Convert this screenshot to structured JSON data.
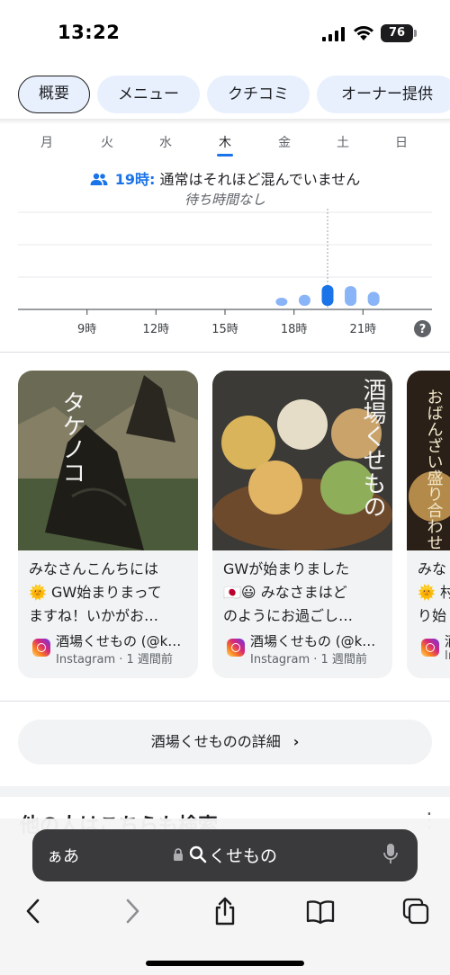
{
  "status_bar": {
    "time": "13:22",
    "battery": "76"
  },
  "tabs": [
    {
      "label": "概要",
      "active": true
    },
    {
      "label": "メニュー",
      "active": false
    },
    {
      "label": "クチコミ",
      "active": false
    },
    {
      "label": "オーナー提供",
      "active": false
    }
  ],
  "popular_times": {
    "days": [
      "月",
      "火",
      "水",
      "木",
      "金",
      "土",
      "日"
    ],
    "selected_day": "木",
    "live_hour": "19時:",
    "live_status": "通常はそれほど混んでいません",
    "wait_time": "待ち時間なし",
    "help_icon": "?",
    "x_ticks": [
      "9時",
      "12時",
      "15時",
      "18時",
      "21時"
    ]
  },
  "chart_data": {
    "type": "bar",
    "categories": [
      "17時",
      "18時",
      "19時",
      "20時",
      "21時",
      "22時"
    ],
    "values": [
      12,
      15,
      25,
      24,
      18,
      3
    ],
    "highlight": "19時",
    "xlim": [
      6,
      24
    ],
    "ylim": [
      0,
      100
    ],
    "colors": {
      "normal": "#8ab4f8",
      "highlight": "#1a73e8",
      "dashed_marker": "#9aa0a6"
    }
  },
  "posts": [
    {
      "image_caption": "タケノコ",
      "text_line1": "みなさんこんちには",
      "text_line2": "🌞 GW始まりまって",
      "text_line3": "ますね！いかがお…",
      "account": "酒場くせもの (@k…",
      "meta": "Instagram · 1 週間前"
    },
    {
      "image_caption": "酒場くせもの",
      "text_line1": "GWが始まりました",
      "text_line2": "🇯🇵😃 みなさまはど",
      "text_line3": "のようにお過ごし…",
      "account": "酒場くせもの (@k…",
      "meta": "Instagram · 1 週間前"
    },
    {
      "image_caption": "おばんざい盛り合わせ",
      "text_line1": "みな",
      "text_line2": "🌞 村",
      "text_line3": "り始",
      "account": "酒",
      "meta": "In"
    }
  ],
  "details_button": "酒場くせものの詳細",
  "next_section": "他の人はこちらも検索",
  "browser": {
    "aa": "ぁあ",
    "url": "くせもの",
    "nav": [
      "back-icon",
      "forward-icon",
      "share-icon",
      "bookmarks-icon",
      "tabs-icon"
    ]
  }
}
